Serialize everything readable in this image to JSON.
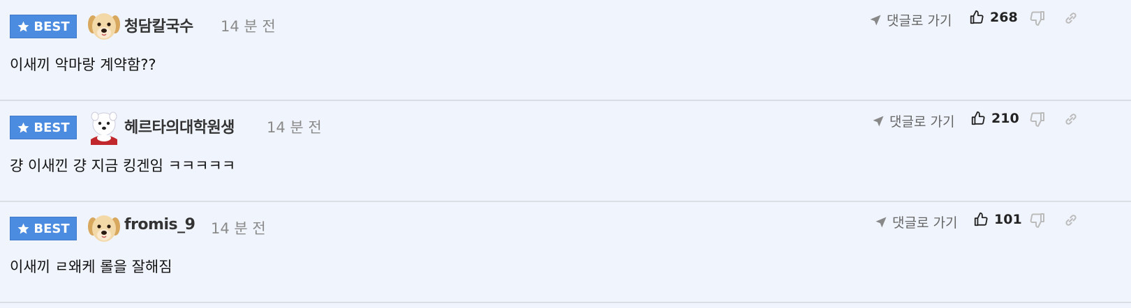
{
  "badge_label": "BEST",
  "goto_label": "댓글로 가기",
  "colors": {
    "badge_bg": "#4b8be0",
    "background": "#f0f4fc",
    "divider": "#d9dde4",
    "meta_text": "#8a8a8a"
  },
  "comments": [
    {
      "author": "청담칼국수",
      "avatar": "puppy-avatar",
      "time": "14 분 전",
      "text": "이새끼 악마랑 계약함??",
      "likes": "268"
    },
    {
      "author": "헤르타의대학원생",
      "avatar": "white-dog-avatar",
      "time": "14 분 전",
      "text": "걍 이새낀 걍 지금 킹겐임 ㅋㅋㅋㅋㅋ",
      "likes": "210"
    },
    {
      "author": "fromis_9",
      "avatar": "puppy-avatar",
      "time": "14 분 전",
      "text": "이새끼 ㄹ왜케 롤을 잘해짐",
      "likes": "101"
    }
  ]
}
